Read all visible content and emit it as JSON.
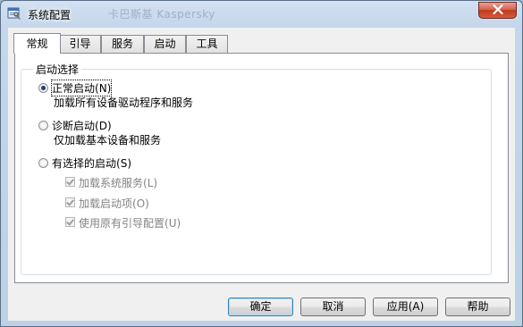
{
  "window": {
    "title": "系统配置",
    "ghost_title": "卡巴斯基 Kaspersky"
  },
  "tabs": [
    {
      "label": "常规",
      "active": true
    },
    {
      "label": "引导",
      "active": false
    },
    {
      "label": "服务",
      "active": false
    },
    {
      "label": "启动",
      "active": false
    },
    {
      "label": "工具",
      "active": false
    }
  ],
  "startup_selection": {
    "group_label": "启动选择",
    "normal": {
      "label": "正常启动",
      "hotkey": "(N)",
      "description": "加载所有设备驱动程序和服务",
      "checked": true
    },
    "diagnostic": {
      "label": "诊断启动",
      "hotkey": "(D)",
      "description": "仅加载基本设备和服务",
      "checked": false
    },
    "selective": {
      "label": "有选择的启动",
      "hotkey": "(S)",
      "checked": false
    },
    "selective_options": [
      {
        "label": "加载系统服务",
        "hotkey": "(L)",
        "checked": true,
        "enabled": false
      },
      {
        "label": "加载启动项",
        "hotkey": "(O)",
        "checked": true,
        "enabled": false
      },
      {
        "label": "使用原有引导配置",
        "hotkey": "(U)",
        "checked": true,
        "enabled": false
      }
    ]
  },
  "buttons": {
    "ok": "确定",
    "cancel": "取消",
    "apply": "应用(A)",
    "help": "帮助"
  },
  "colors": {
    "titlebar": "#c4d6eb",
    "close_button": "#c03a20",
    "default_button_border": "#3c7fb1",
    "disabled_text": "#838383"
  },
  "icons": {
    "app": "msconfig-icon",
    "close": "close-icon"
  }
}
